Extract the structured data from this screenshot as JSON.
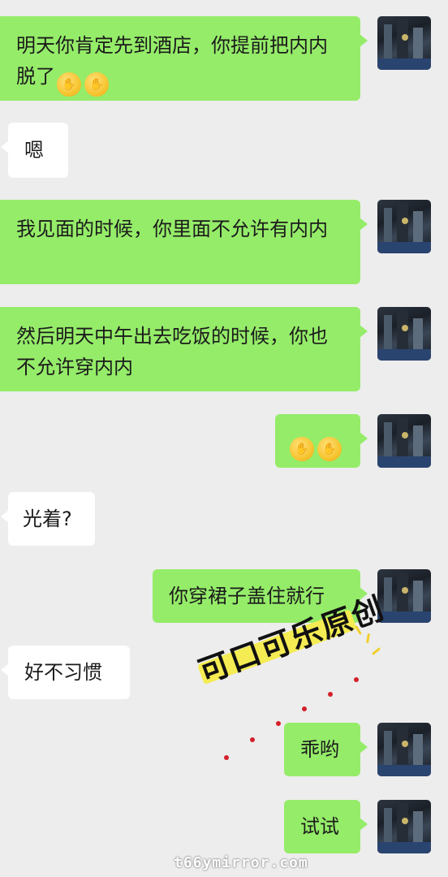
{
  "messages": [
    {
      "side": "out",
      "text": "明天你肯定先到酒店，你提前把内内脱了",
      "emoji_count": 2
    },
    {
      "side": "in",
      "text": "嗯"
    },
    {
      "side": "out",
      "text": "我见面的时候，你里面不允许有内内"
    },
    {
      "side": "out",
      "text": "然后明天中午出去吃饭的时候，你也不允许穿内内"
    },
    {
      "side": "out",
      "text": "",
      "emoji_count": 2
    },
    {
      "side": "in",
      "text": "光着?"
    },
    {
      "side": "out",
      "text": "你穿裙子盖住就行"
    },
    {
      "side": "in",
      "text": "好不习惯"
    },
    {
      "side": "out",
      "text": "乖哟"
    },
    {
      "side": "out",
      "text": "试试"
    }
  ],
  "emoji_name": "face-with-hand-over-mouth",
  "stamp_text": "可口可乐原创",
  "site_watermark": "t66ymirror.com",
  "colors": {
    "background": "#ededed",
    "outgoing_bubble": "#95ec69",
    "incoming_bubble": "#ffffff",
    "stamp_yellow": "#f4ec52"
  }
}
